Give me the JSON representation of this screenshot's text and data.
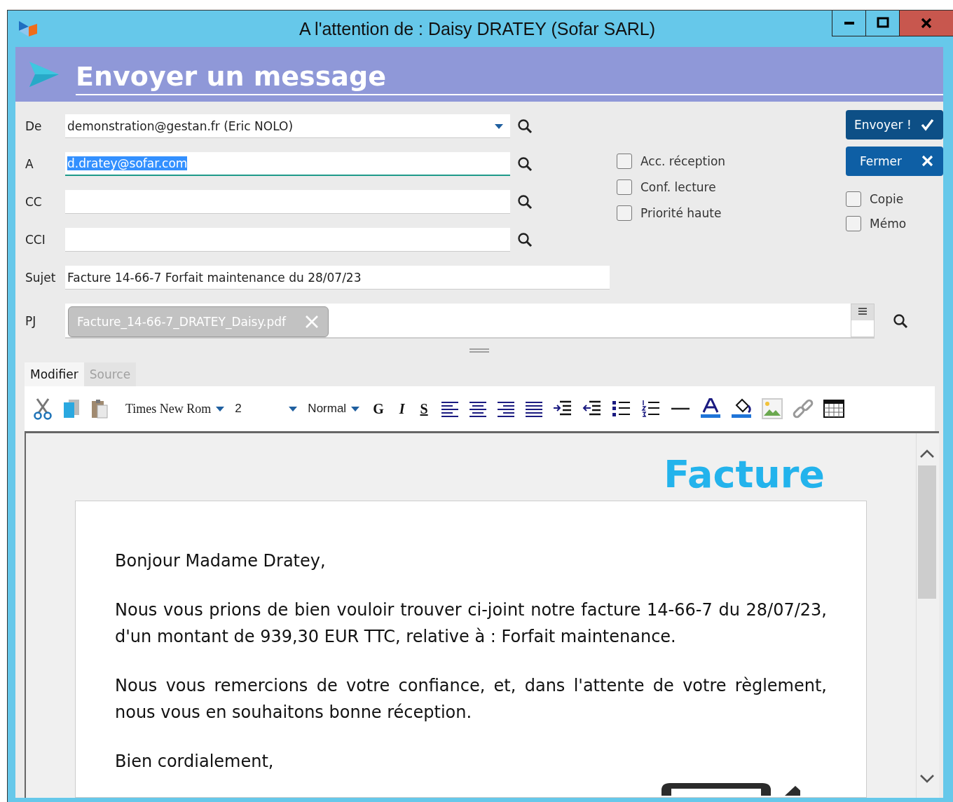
{
  "window": {
    "title": "A l'attention de : Daisy DRATEY (Sofar SARL)"
  },
  "header": {
    "title": "Envoyer un message"
  },
  "fields": [
    {
      "label": "De",
      "value": "demonstration@gestan.fr (Eric NOLO)",
      "kind": "dropdown",
      "focused": false,
      "text_selected": false
    },
    {
      "label": "A",
      "value": "d.dratey@sofar.com",
      "kind": "search",
      "focused": true,
      "text_selected": true
    },
    {
      "label": "CC",
      "kind": "search",
      "focused": false
    },
    {
      "label": "CCI",
      "kind": "search",
      "focused": false
    },
    {
      "label": "Sujet",
      "value": "Facture 14-66-7 Forfait maintenance du 28/07/23",
      "kind": "plain",
      "focused": false,
      "text_selected": false
    }
  ],
  "options": [
    {
      "label": "Acc. réception",
      "checked": false
    },
    {
      "label": "Conf. lecture",
      "checked": false
    },
    {
      "label": "Priorité haute",
      "checked": false
    }
  ],
  "buttons": [
    {
      "label": "Envoyer !",
      "kind": "send"
    },
    {
      "label": "Fermer",
      "kind": "close"
    }
  ],
  "side_options": [
    {
      "label": "Copie",
      "checked": false
    },
    {
      "label": "Mémo",
      "checked": false
    }
  ],
  "attachments": {
    "label": "PJ",
    "files": [
      {
        "name": "Facture_14-66-7_DRATEY_Daisy.pdf"
      }
    ]
  },
  "editor": {
    "tabs": [
      {
        "label": "Modifier",
        "selected": true,
        "disabled": false
      },
      {
        "label": "Source",
        "selected": false,
        "disabled": true
      }
    ],
    "font": "Times New Rom",
    "size": "2",
    "style": "Normal",
    "format_buttons": [
      {
        "label": "G",
        "kind": "bold"
      },
      {
        "label": "I",
        "kind": "italic"
      },
      {
        "label": "S",
        "kind": "underline"
      }
    ]
  },
  "document": {
    "heading": "Facture",
    "paragraphs": [
      "Bonjour Madame Dratey,",
      "Nous vous prions de bien vouloir trouver ci-joint notre facture 14-66-7 du 28/07/23, d'un montant de 939,30 EUR TTC, relative à : Forfait maintenance.",
      "Nous vous remercions de votre confiance, et, dans l'attente de votre règlement, nous vous en souhaitons bonne réception.",
      "Bien cordialement,"
    ]
  }
}
